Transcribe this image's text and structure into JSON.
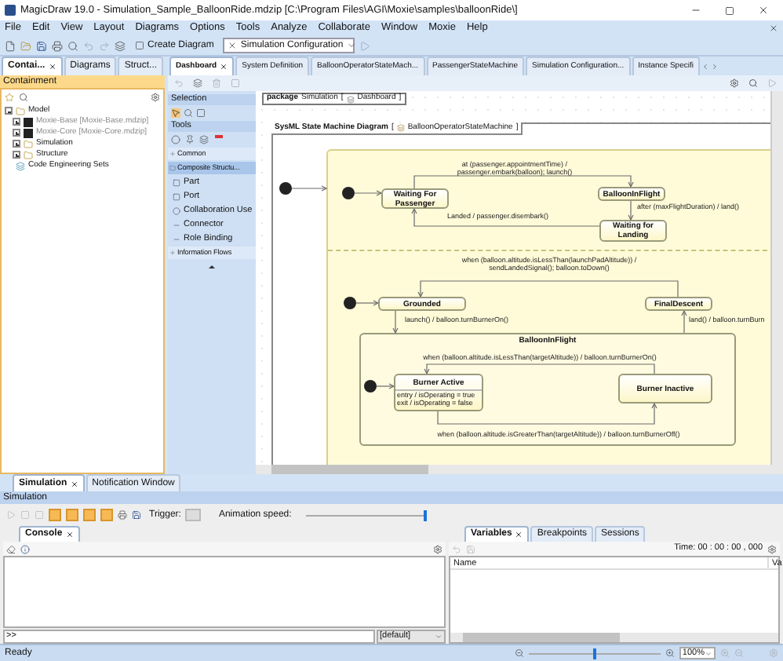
{
  "window": {
    "title": "MagicDraw 19.0 - Simulation_Sample_BalloonRide.mdzip [C:\\Program Files\\AGI\\Moxie\\samples\\balloonRide\\]"
  },
  "menu": [
    "File",
    "Edit",
    "View",
    "Layout",
    "Diagrams",
    "Options",
    "Tools",
    "Analyze",
    "Collaborate",
    "Window",
    "Moxie",
    "Help"
  ],
  "toolbar": {
    "create_diagram": "Create Diagram",
    "configuration": "Simulation Configuration"
  },
  "left_tabs": [
    {
      "label": "Contai...",
      "selected": true
    },
    {
      "label": "Diagrams",
      "selected": false
    },
    {
      "label": "Struct...",
      "selected": false
    }
  ],
  "containment": {
    "title": "Containment",
    "tree": [
      {
        "label": "Model",
        "kind": "model",
        "expanded": true,
        "children": [
          {
            "label": "Moxie-Base [Moxie-Base.mdzip]",
            "kind": "module",
            "expanded": false
          },
          {
            "label": "Moxie-Core [Moxie-Core.mdzip]",
            "kind": "module",
            "expanded": false
          },
          {
            "label": "Simulation",
            "kind": "package",
            "expanded": false
          },
          {
            "label": "Structure",
            "kind": "package",
            "expanded": false
          }
        ]
      },
      {
        "label": "Code Engineering Sets",
        "kind": "sets"
      }
    ]
  },
  "palette": [
    {
      "kind": "header",
      "label": "Selection"
    },
    {
      "kind": "selection-icons"
    },
    {
      "kind": "header",
      "label": "Tools"
    },
    {
      "kind": "tool-icons"
    },
    {
      "kind": "group",
      "label": "Common",
      "expanded": false
    },
    {
      "kind": "group",
      "label": "Composite Structu...",
      "expanded": true
    },
    {
      "kind": "item",
      "label": "Part"
    },
    {
      "kind": "item",
      "label": "Port"
    },
    {
      "kind": "item",
      "label": "Collaboration Use"
    },
    {
      "kind": "item",
      "label": "Connector"
    },
    {
      "kind": "item",
      "label": "Role Binding"
    },
    {
      "kind": "group",
      "label": "Information Flows",
      "expanded": false
    }
  ],
  "editor_tabs": [
    {
      "label": "Dashboard",
      "selected": true
    },
    {
      "label": "System Definition",
      "selected": false
    },
    {
      "label": "BalloonOperatorStateMach...",
      "selected": false
    },
    {
      "label": "PassengerStateMachine",
      "selected": false
    },
    {
      "label": "Simulation Configuration...",
      "selected": false
    },
    {
      "label": "Instance Specifi",
      "selected": false
    }
  ],
  "diagram": {
    "package_frame": {
      "keyword": "package",
      "name": "Simulation",
      "ref_open": "[",
      "ref": "Dashboard",
      "ref_close": "]"
    },
    "frame": {
      "keyword": "SysML State Machine Diagram",
      "name_open": "[",
      "name": "BalloonOperatorStateMachine",
      "name_close": "]"
    },
    "states": [
      {
        "name": "Waiting For Passenger"
      },
      {
        "name": "BalloonInFlight"
      },
      {
        "name": "Waiting for Landing"
      },
      {
        "name": "Grounded"
      },
      {
        "name": "FinalDescent"
      },
      {
        "name": "BalloonInFlight",
        "kind": "composite"
      },
      {
        "name": "Burner Active",
        "activities": [
          "entry / isOperating = true",
          "exit / isOperating = false"
        ]
      },
      {
        "name": "Burner Inactive"
      }
    ],
    "transition_labels": [
      {
        "lines": [
          "at (passenger.appointmentTime) /",
          "passenger.embark(balloon); launch()"
        ]
      },
      {
        "lines": [
          "after (maxFlightDuration) / land()"
        ]
      },
      {
        "lines": [
          "Landed / passenger.disembark()"
        ]
      },
      {
        "lines": [
          "when (balloon.altitude.isLessThan(launchPadAltitude)) /",
          "sendLandedSignal(); balloon.toDown()"
        ]
      },
      {
        "lines": [
          "launch() / balloon.turnBurnerOn()"
        ]
      },
      {
        "lines": [
          "land() / balloon.turnBurn"
        ]
      },
      {
        "lines": [
          "when (balloon.altitude.isLessThan(targetAltitude)) / balloon.turnBurnerOn()"
        ]
      },
      {
        "lines": [
          "when (balloon.altitude.isGreaterThan(targetAltitude)) / balloon.turnBurnerOff()"
        ]
      }
    ]
  },
  "bottom_tabs": [
    {
      "label": "Simulation",
      "selected": true
    },
    {
      "label": "Notification Window",
      "selected": false
    }
  ],
  "simulation": {
    "title": "Simulation",
    "toggles": [
      {
        "on": true
      },
      {
        "on": true
      },
      {
        "on": true
      },
      {
        "on": true
      }
    ],
    "trigger_label": "Trigger:",
    "speed_label": "Animation speed:",
    "speed": {
      "level": 1
    }
  },
  "console": {
    "tabs": [
      {
        "label": "Console",
        "selected": true
      }
    ],
    "prompt": ">>",
    "context": "[default]"
  },
  "variables": {
    "tabs": [
      {
        "label": "Variables",
        "selected": true
      },
      {
        "label": "Breakpoints",
        "selected": false
      },
      {
        "label": "Sessions",
        "selected": false
      }
    ],
    "time": "Time: 00 : 00 : 00 , 000",
    "columns": [
      "Name",
      "Va"
    ]
  },
  "status_bar": {
    "text": "Ready",
    "zoom": "100%",
    "zoom_slider": {
      "level": 0.5
    }
  }
}
